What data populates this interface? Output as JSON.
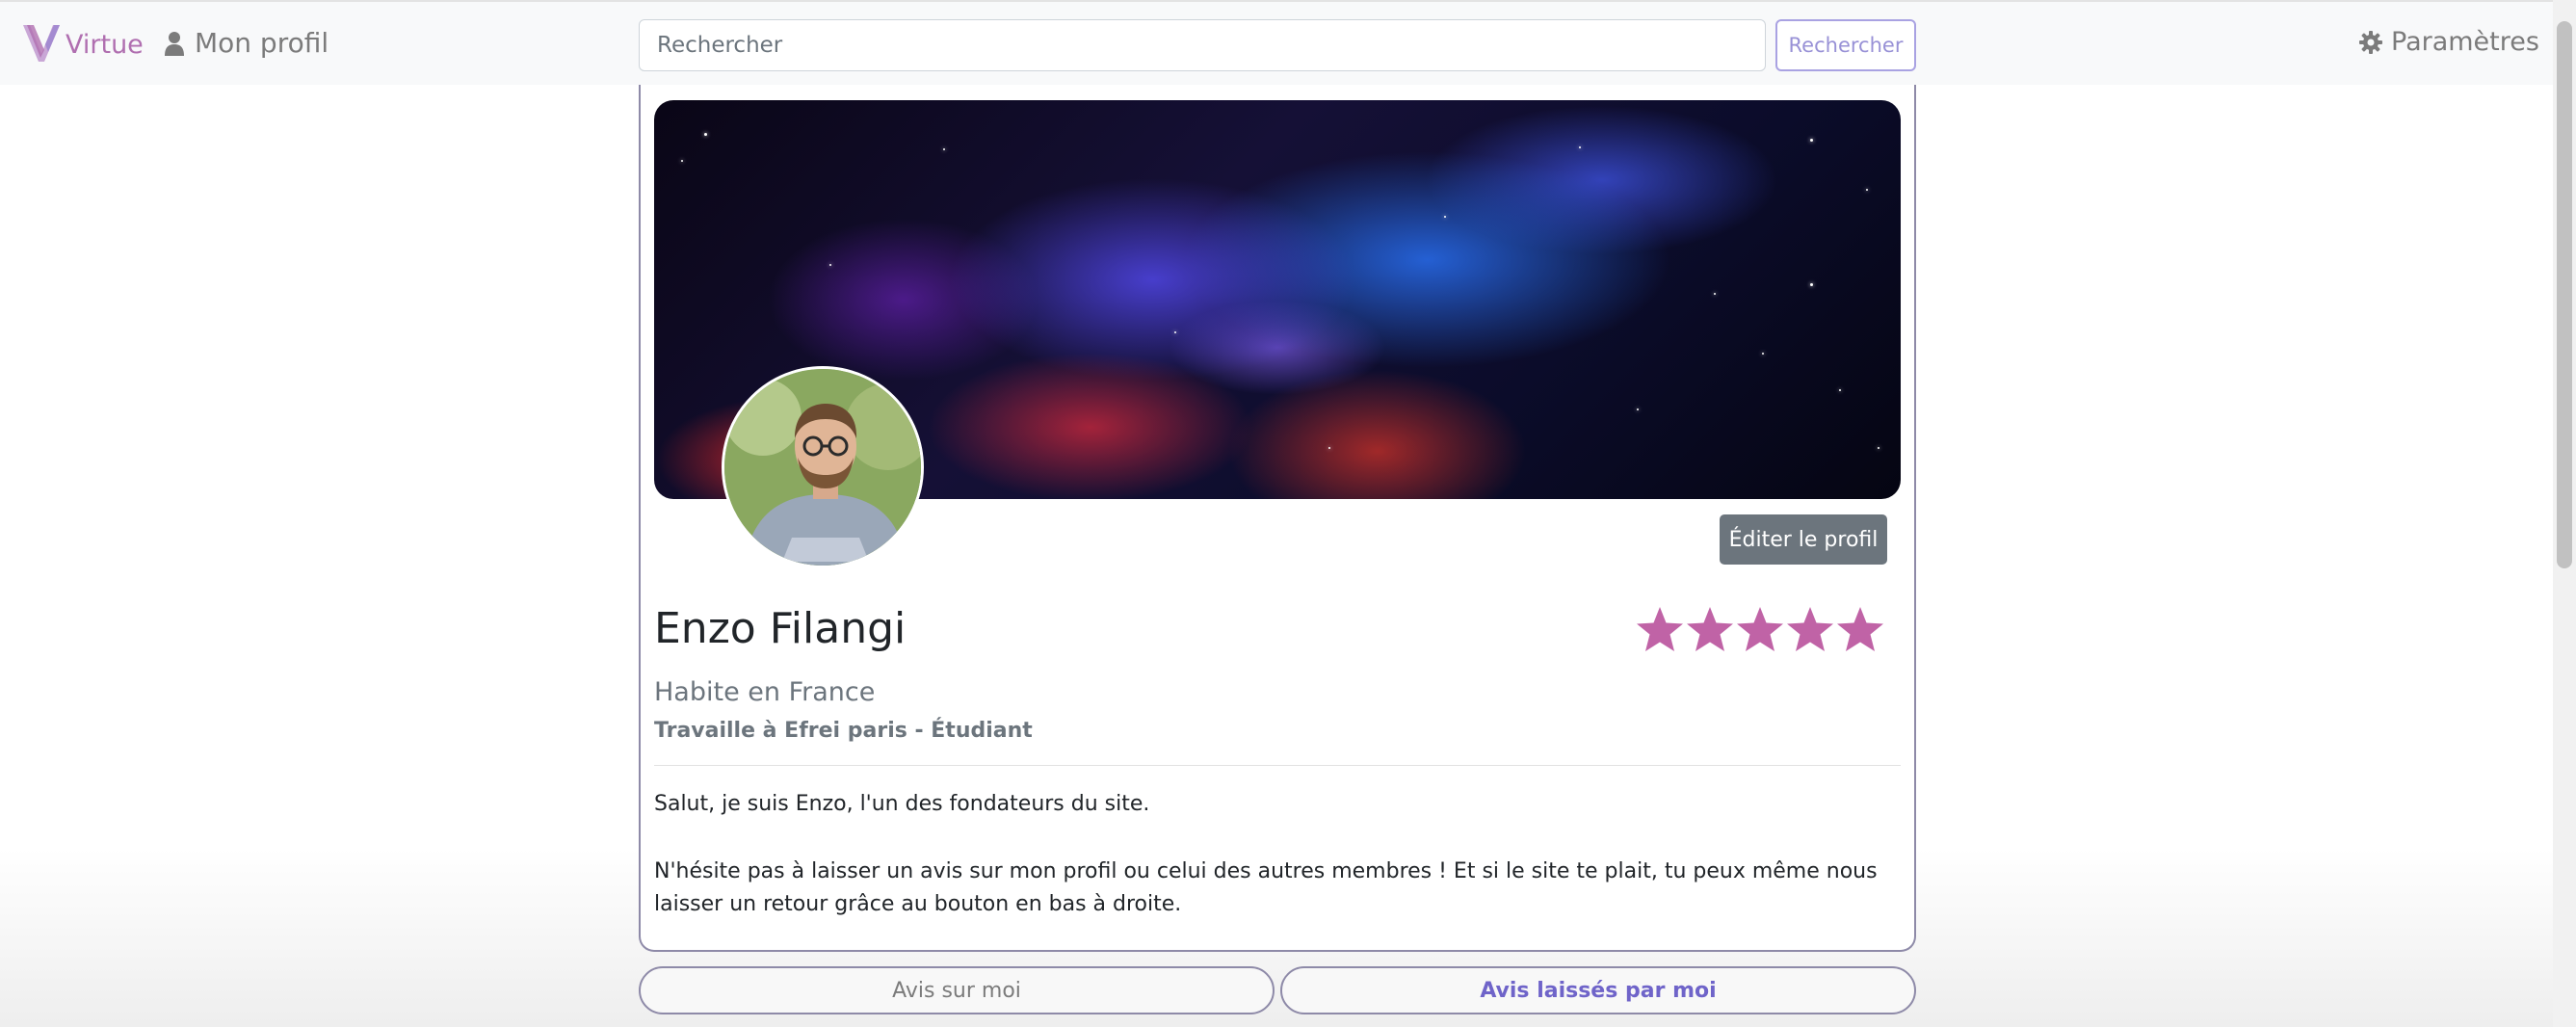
{
  "navbar": {
    "brand": "Virtue",
    "profile_link": "Mon profil",
    "search_placeholder": "Rechercher",
    "search_button": "Rechercher",
    "settings_link": "Paramètres"
  },
  "icons": {
    "brand": "virtue-logo-icon",
    "profile": "user-icon",
    "settings": "gear-icon",
    "rating": "star-icon"
  },
  "profile": {
    "edit_button": "Éditer le profil",
    "name": "Enzo Filangi",
    "location": "Habite en France",
    "job": "Travaille à Efrei paris - Étudiant",
    "rating": 5,
    "rating_max": 5,
    "bio": [
      "Salut, je suis Enzo, l'un des fondateurs du site.",
      "N'hésite pas à laisser un avis sur mon profil ou celui des autres membres ! Et si le site te plait, tu peux même nous laisser un retour grâce au bouton en bas à droite."
    ]
  },
  "tabs": {
    "about_me": "Avis sur moi",
    "left_by_me": "Avis laissés par moi"
  },
  "colors": {
    "brand": "#b06fb0",
    "star": "#c063a6",
    "accent": "#6f64c9",
    "edit_button": "#6c757d"
  }
}
